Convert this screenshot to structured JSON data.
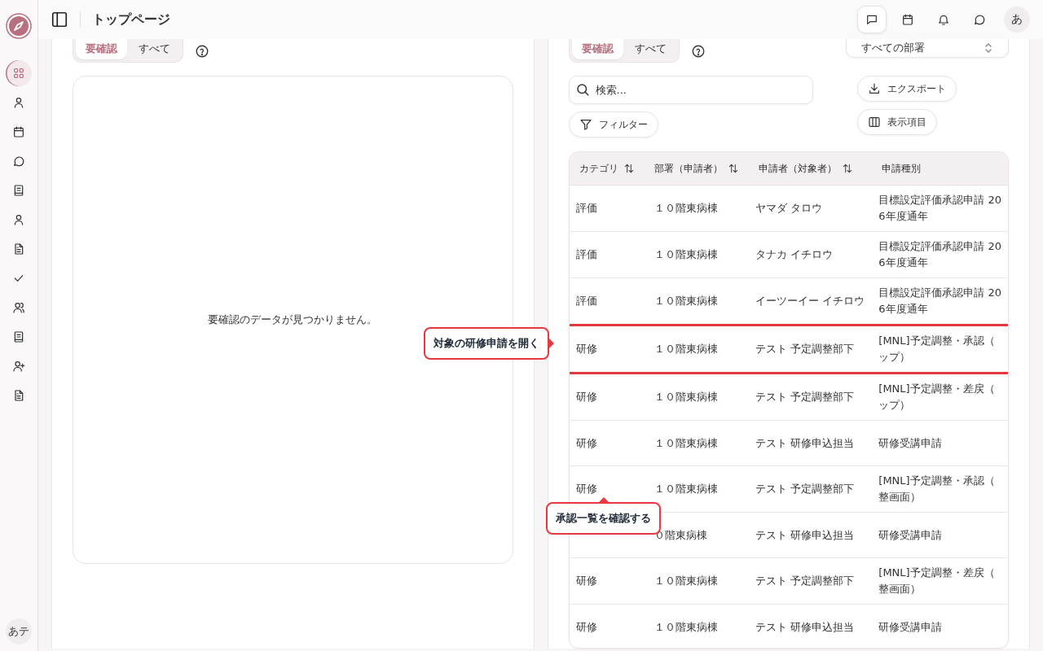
{
  "header": {
    "title": "トップページ",
    "actions": [
      {
        "selected": true
      },
      {
        "selected": false
      },
      {
        "selected": false
      },
      {
        "selected": false
      }
    ],
    "avatar": "あ"
  },
  "sidebar": {
    "items": [
      {
        "selected": true
      },
      {
        "selected": false
      },
      {
        "selected": false
      },
      {
        "selected": false
      },
      {
        "selected": false
      },
      {
        "selected": false
      },
      {
        "selected": false
      },
      {
        "selected": false
      },
      {
        "selected": false
      },
      {
        "selected": false
      },
      {
        "selected": false
      },
      {
        "selected": false
      }
    ],
    "user": "あテ"
  },
  "left_panel": {
    "tabs": [
      {
        "label": "要確認",
        "selected": true
      },
      {
        "label": "すべて",
        "selected": false
      }
    ],
    "empty_message": "要確認のデータが見つかりません。"
  },
  "right_panel": {
    "tabs": [
      {
        "label": "要確認",
        "selected": true
      },
      {
        "label": "すべて",
        "selected": false
      }
    ],
    "department_select": "すべての部署",
    "search": {
      "placeholder": "検索..."
    },
    "filter_button": "フィルター",
    "export_button": "エクスポート",
    "columns_button": "表示項目",
    "table": {
      "columns": [
        {
          "label": "カテゴリ",
          "sortable": true
        },
        {
          "label": "部署（申請者）",
          "sortable": true
        },
        {
          "label": "申請者（対象者）",
          "sortable": true
        },
        {
          "label": "申請種別",
          "sortable": false
        }
      ],
      "rows": [
        {
          "highlighted": false,
          "cells": [
            [
              "評価"
            ],
            [
              "１０階東病棟"
            ],
            [
              "ヤマダ タロウ"
            ],
            [
              "目標設定評価承認申請 20",
              "6年度通年"
            ]
          ]
        },
        {
          "highlighted": false,
          "cells": [
            [
              "評価"
            ],
            [
              "１０階東病棟"
            ],
            [
              "タナカ イチロウ"
            ],
            [
              "目標設定評価承認申請 20",
              "6年度通年"
            ]
          ]
        },
        {
          "highlighted": false,
          "cells": [
            [
              "評価"
            ],
            [
              "１０階東病棟"
            ],
            [
              "イーツーイー イチロウ"
            ],
            [
              "目標設定評価承認申請 20",
              "6年度通年"
            ]
          ]
        },
        {
          "highlighted": true,
          "cells": [
            [
              "研修"
            ],
            [
              "１０階東病棟"
            ],
            [
              "テスト 予定調整部下"
            ],
            [
              "[MNL]予定調整・承認（",
              "ップ）"
            ]
          ]
        },
        {
          "highlighted": false,
          "cells": [
            [
              "研修"
            ],
            [
              "１０階東病棟"
            ],
            [
              "テスト 予定調整部下"
            ],
            [
              "[MNL]予定調整・差戻（",
              "ップ）"
            ]
          ]
        },
        {
          "highlighted": false,
          "cells": [
            [
              "研修"
            ],
            [
              "１０階東病棟"
            ],
            [
              "テスト 研修申込担当"
            ],
            [
              "研修受講申請"
            ]
          ]
        },
        {
          "highlighted": false,
          "cells": [
            [
              "研修"
            ],
            [
              "１０階東病棟"
            ],
            [
              "テスト 予定調整部下"
            ],
            [
              "[MNL]予定調整・承認（",
              "整画面）"
            ]
          ]
        },
        {
          "highlighted": false,
          "cells": [
            [],
            [
              "０階東病棟"
            ],
            [
              "テスト 研修申込担当"
            ],
            [
              "研修受講申請"
            ]
          ]
        },
        {
          "highlighted": false,
          "cells": [
            [
              "研修"
            ],
            [
              "１０階東病棟"
            ],
            [
              "テスト 予定調整部下"
            ],
            [
              "[MNL]予定調整・差戻（",
              "整画面）"
            ]
          ]
        },
        {
          "highlighted": false,
          "cells": [
            [
              "研修"
            ],
            [
              "１０階東病棟"
            ],
            [
              "テスト 研修申込担当"
            ],
            [
              "研修受講申請"
            ]
          ]
        }
      ]
    }
  },
  "callouts": [
    {
      "text": "対象の研修申請を開く",
      "kind": "right"
    },
    {
      "text": "承認一覧を確認する",
      "kind": "up"
    }
  ]
}
